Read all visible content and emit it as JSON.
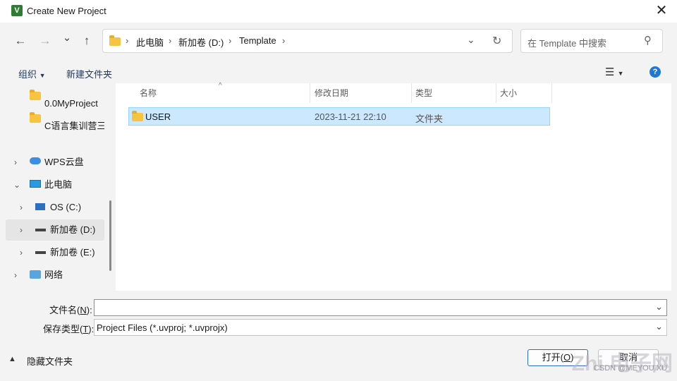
{
  "window": {
    "title": "Create New Project",
    "app_icon_letter": "V"
  },
  "nav": {
    "back": "←",
    "forward": "→",
    "recent": "⌄",
    "up": "↑"
  },
  "address": {
    "crumbs": [
      "此电脑",
      "新加卷 (D:)",
      "Template"
    ],
    "separator": "›"
  },
  "search": {
    "placeholder": "在 Template 中搜索"
  },
  "toolbar": {
    "organize": "组织",
    "new_folder": "新建文件夹",
    "help": "?"
  },
  "sidebar": {
    "items": [
      {
        "label": "0.0MyProject",
        "icon": "folder-icon"
      },
      {
        "label": "C语言集训营三期",
        "icon": "folder-icon"
      },
      {
        "label": "WPS云盘",
        "icon": "cloud-icon"
      },
      {
        "label": "此电脑",
        "icon": "computer-icon"
      },
      {
        "label": "OS (C:)",
        "icon": "drive-icon"
      },
      {
        "label": "新加卷 (D:)",
        "icon": "drive-icon"
      },
      {
        "label": "新加卷 (E:)",
        "icon": "drive-icon"
      },
      {
        "label": "网络",
        "icon": "network-icon"
      }
    ]
  },
  "columns": {
    "name": "名称",
    "modified": "修改日期",
    "type": "类型",
    "size": "大小"
  },
  "files": [
    {
      "name": "USER",
      "modified": "2023-11-21 22:10",
      "type": "文件夹",
      "size": ""
    }
  ],
  "form": {
    "filename_label": "文件名(N):",
    "filename_label_pre": "文件名(",
    "filename_label_key": "N",
    "filename_label_post": "):",
    "filename_value": "",
    "filetype_label_pre": "保存类型(",
    "filetype_label_key": "T",
    "filetype_label_post": "):",
    "filetype_value": "Project Files (*.uvproj; *.uvprojx)"
  },
  "footer": {
    "hide_folders": "隐藏文件夹",
    "open_pre": "打开(",
    "open_key": "O",
    "open_post": ")",
    "cancel": "取消"
  },
  "watermark": {
    "text": "Zhi 电子网",
    "sub": "CSDN @MEYOU.XU"
  }
}
